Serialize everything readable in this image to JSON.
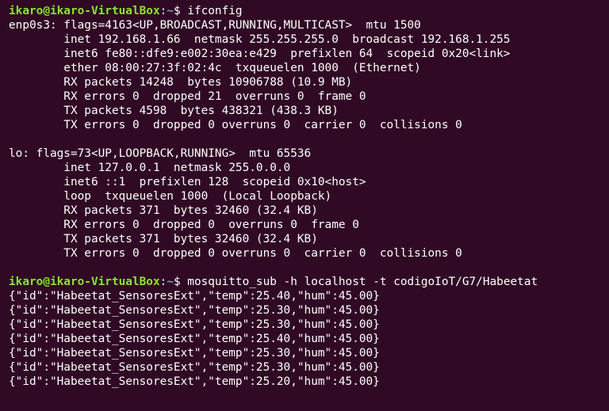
{
  "colors": {
    "background": "#300a24",
    "foreground": "#ffffff",
    "prompt_user": "#8ae234",
    "prompt_path": "#729fcf"
  },
  "prompt1": {
    "user_host": "ikaro@ikaro-VirtualBox",
    "colon": ":",
    "path": "~",
    "symbol": "$ ",
    "command": "ifconfig"
  },
  "ifconfig_output": [
    "enp0s3: flags=4163<UP,BROADCAST,RUNNING,MULTICAST>  mtu 1500",
    "        inet 192.168.1.66  netmask 255.255.255.0  broadcast 192.168.1.255",
    "        inet6 fe80::dfe9:e002:30ea:e429  prefixlen 64  scopeid 0x20<link>",
    "        ether 08:00:27:3f:02:4c  txqueuelen 1000  (Ethernet)",
    "        RX packets 14248  bytes 10906788 (10.9 MB)",
    "        RX errors 0  dropped 21  overruns 0  frame 0",
    "        TX packets 4598  bytes 438321 (438.3 KB)",
    "        TX errors 0  dropped 0 overruns 0  carrier 0  collisions 0",
    "",
    "lo: flags=73<UP,LOOPBACK,RUNNING>  mtu 65536",
    "        inet 127.0.0.1  netmask 255.0.0.0",
    "        inet6 ::1  prefixlen 128  scopeid 0x10<host>",
    "        loop  txqueuelen 1000  (Local Loopback)",
    "        RX packets 371  bytes 32460 (32.4 KB)",
    "        RX errors 0  dropped 0  overruns 0  frame 0",
    "        TX packets 371  bytes 32460 (32.4 KB)",
    "        TX errors 0  dropped 0 overruns 0  carrier 0  collisions 0",
    ""
  ],
  "prompt2": {
    "user_host": "ikaro@ikaro-VirtualBox",
    "colon": ":",
    "path": "~",
    "symbol": "$ ",
    "command": "mosquitto_sub -h localhost -t codigoIoT/G7/Habeetat"
  },
  "mqtt_output": [
    "{\"id\":\"Habeetat_SensoresExt\",\"temp\":25.40,\"hum\":45.00}",
    "{\"id\":\"Habeetat_SensoresExt\",\"temp\":25.30,\"hum\":45.00}",
    "{\"id\":\"Habeetat_SensoresExt\",\"temp\":25.30,\"hum\":45.00}",
    "{\"id\":\"Habeetat_SensoresExt\",\"temp\":25.40,\"hum\":45.00}",
    "{\"id\":\"Habeetat_SensoresExt\",\"temp\":25.30,\"hum\":45.00}",
    "{\"id\":\"Habeetat_SensoresExt\",\"temp\":25.30,\"hum\":45.00}",
    "{\"id\":\"Habeetat_SensoresExt\",\"temp\":25.20,\"hum\":45.00}"
  ]
}
